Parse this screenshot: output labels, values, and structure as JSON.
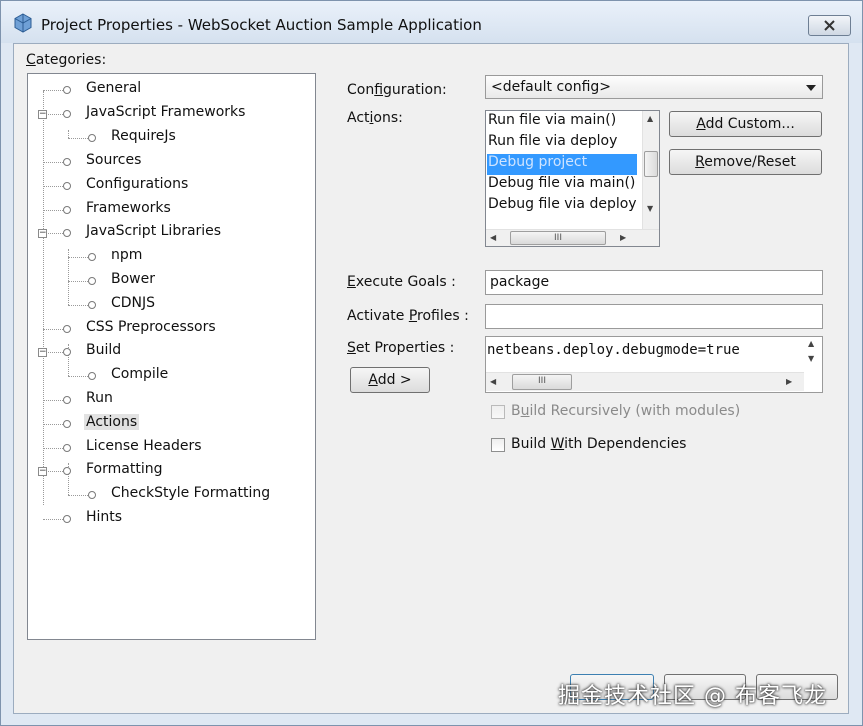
{
  "window": {
    "title": "Project Properties - WebSocket Auction Sample Application"
  },
  "categories": {
    "label_access": "C",
    "label_rest": "ategories:",
    "items": [
      {
        "label": "General"
      },
      {
        "label": "JavaScript Frameworks"
      },
      {
        "label": "RequireJs"
      },
      {
        "label": "Sources"
      },
      {
        "label": "Configurations"
      },
      {
        "label": "Frameworks"
      },
      {
        "label": "JavaScript Libraries"
      },
      {
        "label": "npm"
      },
      {
        "label": "Bower"
      },
      {
        "label": "CDNJS"
      },
      {
        "label": "CSS Preprocessors"
      },
      {
        "label": "Build"
      },
      {
        "label": "Compile"
      },
      {
        "label": "Run"
      },
      {
        "label": "Actions"
      },
      {
        "label": "License Headers"
      },
      {
        "label": "Formatting"
      },
      {
        "label": "CheckStyle Formatting"
      },
      {
        "label": "Hints"
      }
    ],
    "selected": "Actions"
  },
  "form": {
    "configuration_pre": "Con",
    "configuration_access": "f",
    "configuration_post": "iguration:",
    "configuration_value": "<default config>",
    "actions_pre": "Act",
    "actions_access": "i",
    "actions_post": "ons:",
    "actions_list": [
      "Run file via main()",
      "Run file via deploy",
      "Debug project",
      "Debug file via main()",
      "Debug file via deploy"
    ],
    "actions_selected": "Debug project",
    "add_custom_access": "A",
    "add_custom_rest": "dd Custom...",
    "remove_reset_access": "R",
    "remove_reset_rest": "emove/Reset",
    "execute_goals_access": "E",
    "execute_goals_rest": "xecute Goals :",
    "execute_goals_value": "package",
    "activate_profiles_pre": "Activate ",
    "activate_profiles_access": "P",
    "activate_profiles_post": "rofiles :",
    "activate_profiles_value": "",
    "set_properties_access": "S",
    "set_properties_rest": "et Properties :",
    "set_properties_value": "netbeans.deploy.debugmode=true",
    "add_button_access": "A",
    "add_button_rest": "dd >",
    "build_recursively_pre": "B",
    "build_recursively_access": "u",
    "build_recursively_post": "ild Recursively (with modules)",
    "build_with_deps_pre": "Build ",
    "build_with_deps_access": "W",
    "build_with_deps_post": "ith Dependencies"
  },
  "icons": {
    "app_icon": "netbeans-cube-icon",
    "close": "close-icon"
  },
  "watermark": "掘金技术社区 @ 布客飞龙"
}
